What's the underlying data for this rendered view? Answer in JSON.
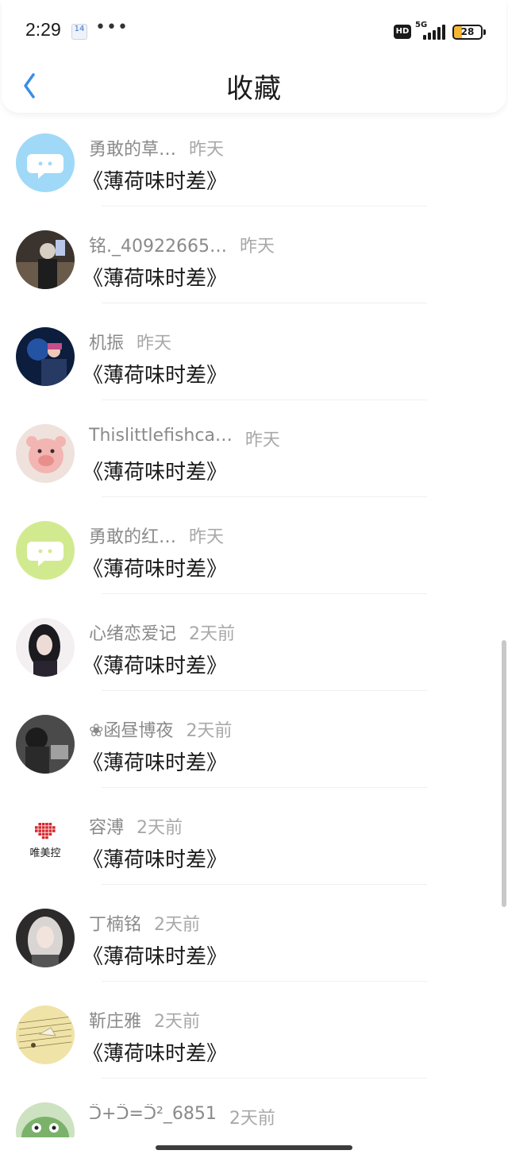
{
  "status_bar": {
    "time": "2:29",
    "calendar_day": "14",
    "more": "•••",
    "hd": "HD",
    "network": "5G",
    "battery": "28",
    "battery_level": 0.28
  },
  "header": {
    "title": "收藏",
    "back_icon": "chevron-left-icon"
  },
  "items": [
    {
      "name": "勇敢的草…",
      "time": "昨天",
      "title": "《薄荷味时差》",
      "avatar": "wechat-blue"
    },
    {
      "name": "铭._40922665…",
      "time": "昨天",
      "title": "《薄荷味时差》",
      "avatar": "photo-dark"
    },
    {
      "name": "机振",
      "time": "昨天",
      "title": "《薄荷味时差》",
      "avatar": "photo-night"
    },
    {
      "name": "Thislittlefishca…",
      "time": "昨天",
      "title": "《薄荷味时差》",
      "avatar": "photo-pig"
    },
    {
      "name": "勇敢的红…",
      "time": "昨天",
      "title": "《薄荷味时差》",
      "avatar": "wechat-green"
    },
    {
      "name": "心绪恋爱记",
      "time": "2天前",
      "title": "《薄荷味时差》",
      "avatar": "photo-girl-dark"
    },
    {
      "name": "❀函昼博夜",
      "time": "2天前",
      "title": "《薄荷味时差》",
      "avatar": "photo-grey"
    },
    {
      "name": "容溥",
      "time": "2天前",
      "title": "《薄荷味时差》",
      "avatar": "logo-weimeikong",
      "avatar_text": "唯美控"
    },
    {
      "name": "丁楠铭",
      "time": "2天前",
      "title": "《薄荷味时差》",
      "avatar": "photo-girl-light"
    },
    {
      "name": "靳庄雅",
      "time": "2天前",
      "title": "《薄荷味时差》",
      "avatar": "photo-music"
    },
    {
      "name": "ᑒ+ᑒ=ᑒ²_6851",
      "time": "2天前",
      "title": "",
      "avatar": "photo-frog"
    }
  ],
  "colors": {
    "accent": "#3a8ee6",
    "name": "#8a8a8a",
    "time": "#a8a8a8"
  }
}
